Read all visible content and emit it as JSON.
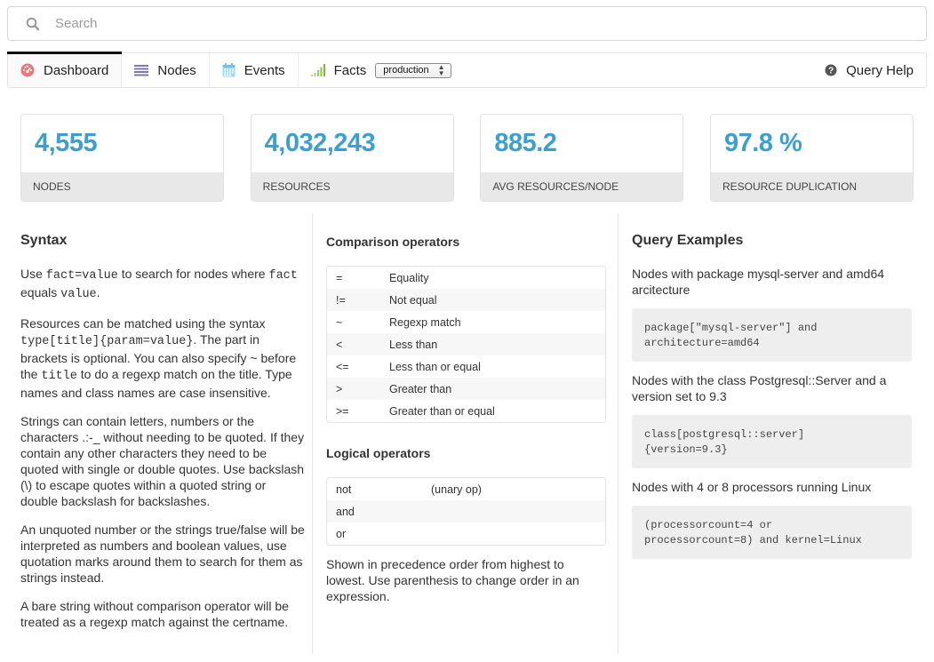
{
  "search": {
    "placeholder": "Search",
    "value": "",
    "icon": "search-icon"
  },
  "nav": {
    "tabs": [
      {
        "label": "Dashboard",
        "icon": "dashboard-icon",
        "icon_color": "#e06b6b",
        "active": true
      },
      {
        "label": "Nodes",
        "icon": "list-icon",
        "icon_color": "#7b78b5",
        "active": false
      },
      {
        "label": "Events",
        "icon": "calendar-icon",
        "icon_color": "#6fc3e8",
        "active": false
      },
      {
        "label": "Facts",
        "icon": "signal-bars-icon",
        "icon_color": "#8ac53f",
        "active": false
      }
    ],
    "environment_select": {
      "value": "production"
    },
    "help": {
      "label": "Query Help",
      "icon": "question-circle-icon"
    }
  },
  "stats": [
    {
      "value": "4,555",
      "label": "NODES"
    },
    {
      "value": "4,032,243",
      "label": "RESOURCES"
    },
    {
      "value": "885.2",
      "label": "AVG RESOURCES/NODE"
    },
    {
      "value": "97.8 %",
      "label": "RESOURCE DUPLICATION"
    }
  ],
  "syntax": {
    "title": "Syntax",
    "p1": {
      "t1": "Use ",
      "c1": "fact=value",
      "t2": " to search for nodes where ",
      "c2": "fact",
      "t3": " equals ",
      "c3": "value",
      "t4": "."
    },
    "p2": {
      "t1": "Resources can be matched using the syntax ",
      "c1": "type[title]{param=value}",
      "t2": ". The part in brackets is optional. You can also specify ~ before the ",
      "c2": "title",
      "t3": " to do a regexp match on the title. Type names and class names are case insensitive."
    },
    "p3": "Strings can contain letters, numbers or the characters .:-_ without needing to be quoted. If they contain any other characters they need to be quoted with single or double quotes. Use backslash (\\) to escape quotes within a quoted string or double backslash for backslashes.",
    "p4": "An unquoted number or the strings true/false will be interpreted as numbers and boolean values, use quotation marks around them to search for them as strings instead.",
    "p5": "A bare string without comparison operator will be treated as a regexp match against the certname."
  },
  "comparison": {
    "title": "Comparison operators",
    "rows": [
      {
        "op": "=",
        "desc": "Equality"
      },
      {
        "op": "!=",
        "desc": "Not equal"
      },
      {
        "op": "~",
        "desc": "Regexp match"
      },
      {
        "op": "<",
        "desc": "Less than"
      },
      {
        "op": "<=",
        "desc": "Less than or equal"
      },
      {
        "op": ">",
        "desc": "Greater than"
      },
      {
        "op": ">=",
        "desc": "Greater than or equal"
      }
    ]
  },
  "logical": {
    "title": "Logical operators",
    "rows": [
      {
        "op": "not",
        "desc": "(unary op)"
      },
      {
        "op": "and",
        "desc": ""
      },
      {
        "op": "or",
        "desc": ""
      }
    ],
    "note": "Shown in precedence order from highest to lowest. Use parenthesis to change order in an expression."
  },
  "examples": {
    "title": "Query Examples",
    "items": [
      {
        "desc": "Nodes with package mysql-server and amd64 arcitecture",
        "code": "package[\"mysql-server\"] and\narchitecture=amd64"
      },
      {
        "desc": "Nodes with the class Postgresql::Server and a version set to 9.3",
        "code": "class[postgresql::server]\n{version=9.3}"
      },
      {
        "desc": "Nodes with 4 or 8 processors running Linux",
        "code": "(processorcount=4 or\nprocessorcount=8) and kernel=Linux"
      }
    ]
  }
}
